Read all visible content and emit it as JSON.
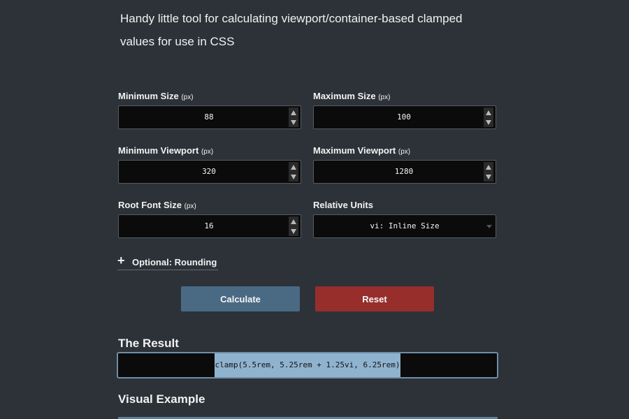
{
  "intro": {
    "line1": "Handy little tool for calculating viewport/container-based clamped",
    "line2": "values for use in CSS"
  },
  "fields": {
    "min_size": {
      "label": "Minimum Size",
      "unit": "(px)",
      "value": "88"
    },
    "max_size": {
      "label": "Maximum Size",
      "unit": "(px)",
      "value": "100"
    },
    "min_viewport": {
      "label": "Minimum Viewport",
      "unit": "(px)",
      "value": "320"
    },
    "max_viewport": {
      "label": "Maximum Viewport",
      "unit": "(px)",
      "value": "1280"
    },
    "root_font": {
      "label": "Root Font Size",
      "unit": "(px)",
      "value": "16"
    },
    "relative_units": {
      "label": "Relative Units",
      "value": "vi: Inline Size"
    }
  },
  "optional": {
    "icon": "plus-icon",
    "label": "Optional: Rounding"
  },
  "buttons": {
    "calculate": "Calculate",
    "reset": "Reset"
  },
  "colors": {
    "calculate": "#4a6a84",
    "reset": "#972e2c",
    "highlight": "#8fb3cf"
  },
  "result": {
    "title": "The Result",
    "value": "clamp(5.5rem, 5.25rem + 1.25vi, 6.25rem)"
  },
  "visual": {
    "title": "Visual Example"
  }
}
